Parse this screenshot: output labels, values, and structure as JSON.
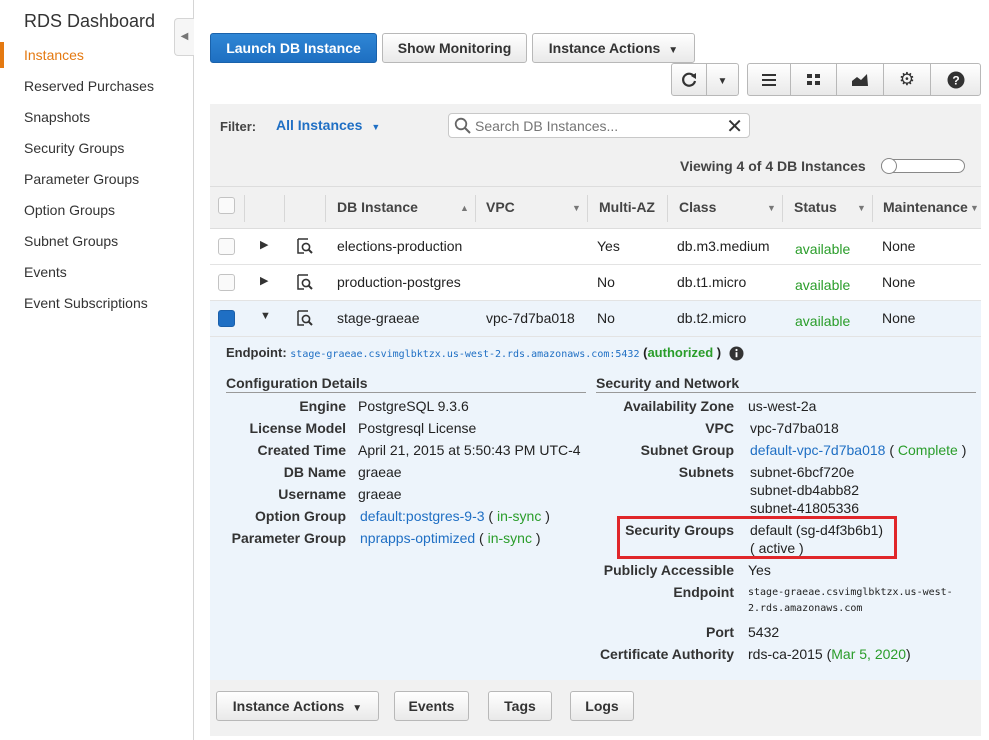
{
  "sidebar": {
    "title": "RDS Dashboard",
    "collapse_icon": "chevron-left-icon",
    "items": [
      {
        "label": "Instances",
        "active": true
      },
      {
        "label": "Reserved Purchases"
      },
      {
        "label": "Snapshots"
      },
      {
        "label": "Security Groups"
      },
      {
        "label": "Parameter Groups"
      },
      {
        "label": "Option Groups"
      },
      {
        "label": "Subnet Groups"
      },
      {
        "label": "Events"
      },
      {
        "label": "Event Subscriptions"
      }
    ]
  },
  "toolbar": {
    "launch_label": "Launch DB Instance",
    "monitoring_label": "Show Monitoring",
    "actions_label": "Instance Actions",
    "icons": [
      "refresh-icon",
      "chevron-down-icon",
      "list-view-icon",
      "grid-view-icon",
      "chart-icon",
      "gear-icon",
      "help-icon"
    ]
  },
  "filter": {
    "label": "Filter:",
    "value": "All Instances",
    "search_placeholder": "Search DB Instances...",
    "viewing_text": "Viewing 4 of 4 DB Instances"
  },
  "table": {
    "columns": [
      "DB Instance",
      "VPC",
      "Multi-AZ",
      "Class",
      "Status",
      "Maintenance"
    ],
    "rows": [
      {
        "instance": "elections-production",
        "vpc": "",
        "multi_az": "Yes",
        "class": "db.m3.medium",
        "status": "available",
        "maintenance": "None",
        "expanded": false,
        "checked": false
      },
      {
        "instance": "production-postgres",
        "vpc": "",
        "multi_az": "No",
        "class": "db.t1.micro",
        "status": "available",
        "maintenance": "None",
        "expanded": false,
        "checked": false
      },
      {
        "instance": "stage-graeae",
        "vpc": "vpc-7d7ba018",
        "multi_az": "No",
        "class": "db.t2.micro",
        "status": "available",
        "maintenance": "None",
        "expanded": true,
        "checked": true
      }
    ]
  },
  "details": {
    "endpoint_label": "Endpoint:",
    "endpoint_value": "stage-graeae.csvimglbktzx.us-west-2.rds.amazonaws.com:5432",
    "endpoint_status": "authorized",
    "config_title": "Configuration Details",
    "config": [
      {
        "key": "Engine",
        "value": "PostgreSQL 9.3.6"
      },
      {
        "key": "License Model",
        "value": "Postgresql License"
      },
      {
        "key": "Created Time",
        "value": "April 21, 2015 at 5:50:43 PM UTC-4"
      },
      {
        "key": "DB Name",
        "value": "graeae"
      },
      {
        "key": "Username",
        "value": "graeae"
      },
      {
        "key": "Option Group",
        "value": "default:postgres-9-3",
        "status": "in-sync"
      },
      {
        "key": "Parameter Group",
        "value": "nprapps-optimized",
        "status": "in-sync"
      }
    ],
    "security_title": "Security and Network",
    "security": {
      "availability_zone_key": "Availability Zone",
      "availability_zone": "us-west-2a",
      "vpc_key": "VPC",
      "vpc": "vpc-7d7ba018",
      "subnet_group_key": "Subnet Group",
      "subnet_group": "default-vpc-7d7ba018",
      "subnet_group_status": "Complete",
      "subnets_key": "Subnets",
      "subnets": [
        "subnet-6bcf720e",
        "subnet-db4abb82",
        "subnet-41805336"
      ],
      "security_groups_key": "Security Groups",
      "security_group": "default (sg-d4f3b6b1)",
      "security_group_status": "active",
      "public_key": "Publicly Accessible",
      "public": "Yes",
      "endpoint_key": "Endpoint",
      "endpoint_line1": "stage-graeae.csvimglbktzx.us-west-",
      "endpoint_line2": "2.rds.amazonaws.com",
      "port_key": "Port",
      "port": "5432",
      "ca_key": "Certificate Authority",
      "ca": "rds-ca-2015",
      "ca_date": "Mar 5, 2020"
    }
  },
  "bottom_bar": {
    "actions_label": "Instance Actions",
    "events_label": "Events",
    "tags_label": "Tags",
    "logs_label": "Logs"
  },
  "colors": {
    "accent": "#e47911",
    "primary": "#1f6fc4",
    "available": "#2a9d2a",
    "highlight": "#e0262a"
  }
}
